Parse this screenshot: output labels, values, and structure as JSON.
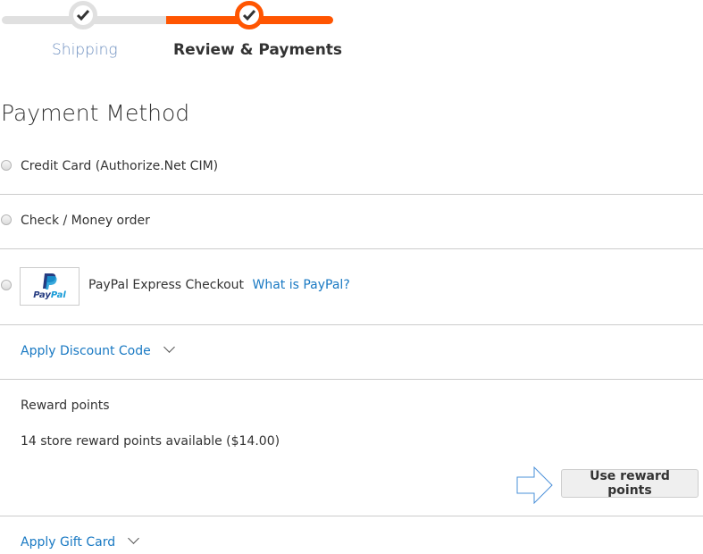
{
  "progress": {
    "steps": [
      {
        "label": "Shipping",
        "state": "complete"
      },
      {
        "label": "Review & Payments",
        "state": "active"
      }
    ],
    "colors": {
      "active": "#ff5501",
      "inactive": "#e0e0e0"
    }
  },
  "payment": {
    "title": "Payment Method",
    "methods": [
      {
        "label": "Credit Card (Authorize.Net CIM)",
        "selected": false
      },
      {
        "label": "Check / Money order",
        "selected": false
      },
      {
        "label": "PayPal Express Checkout",
        "selected": false,
        "logo_text_a": "Pay",
        "logo_text_b": "Pal",
        "link": "What is PayPal?"
      }
    ]
  },
  "discount": {
    "label": "Apply Discount Code"
  },
  "reward": {
    "title": "Reward points",
    "available": "14 store reward points available ($14.00)",
    "button": "Use reward points"
  },
  "giftcard": {
    "label": "Apply Gift Card"
  },
  "colors": {
    "link": "#1979c3",
    "accent": "#ff5501"
  }
}
